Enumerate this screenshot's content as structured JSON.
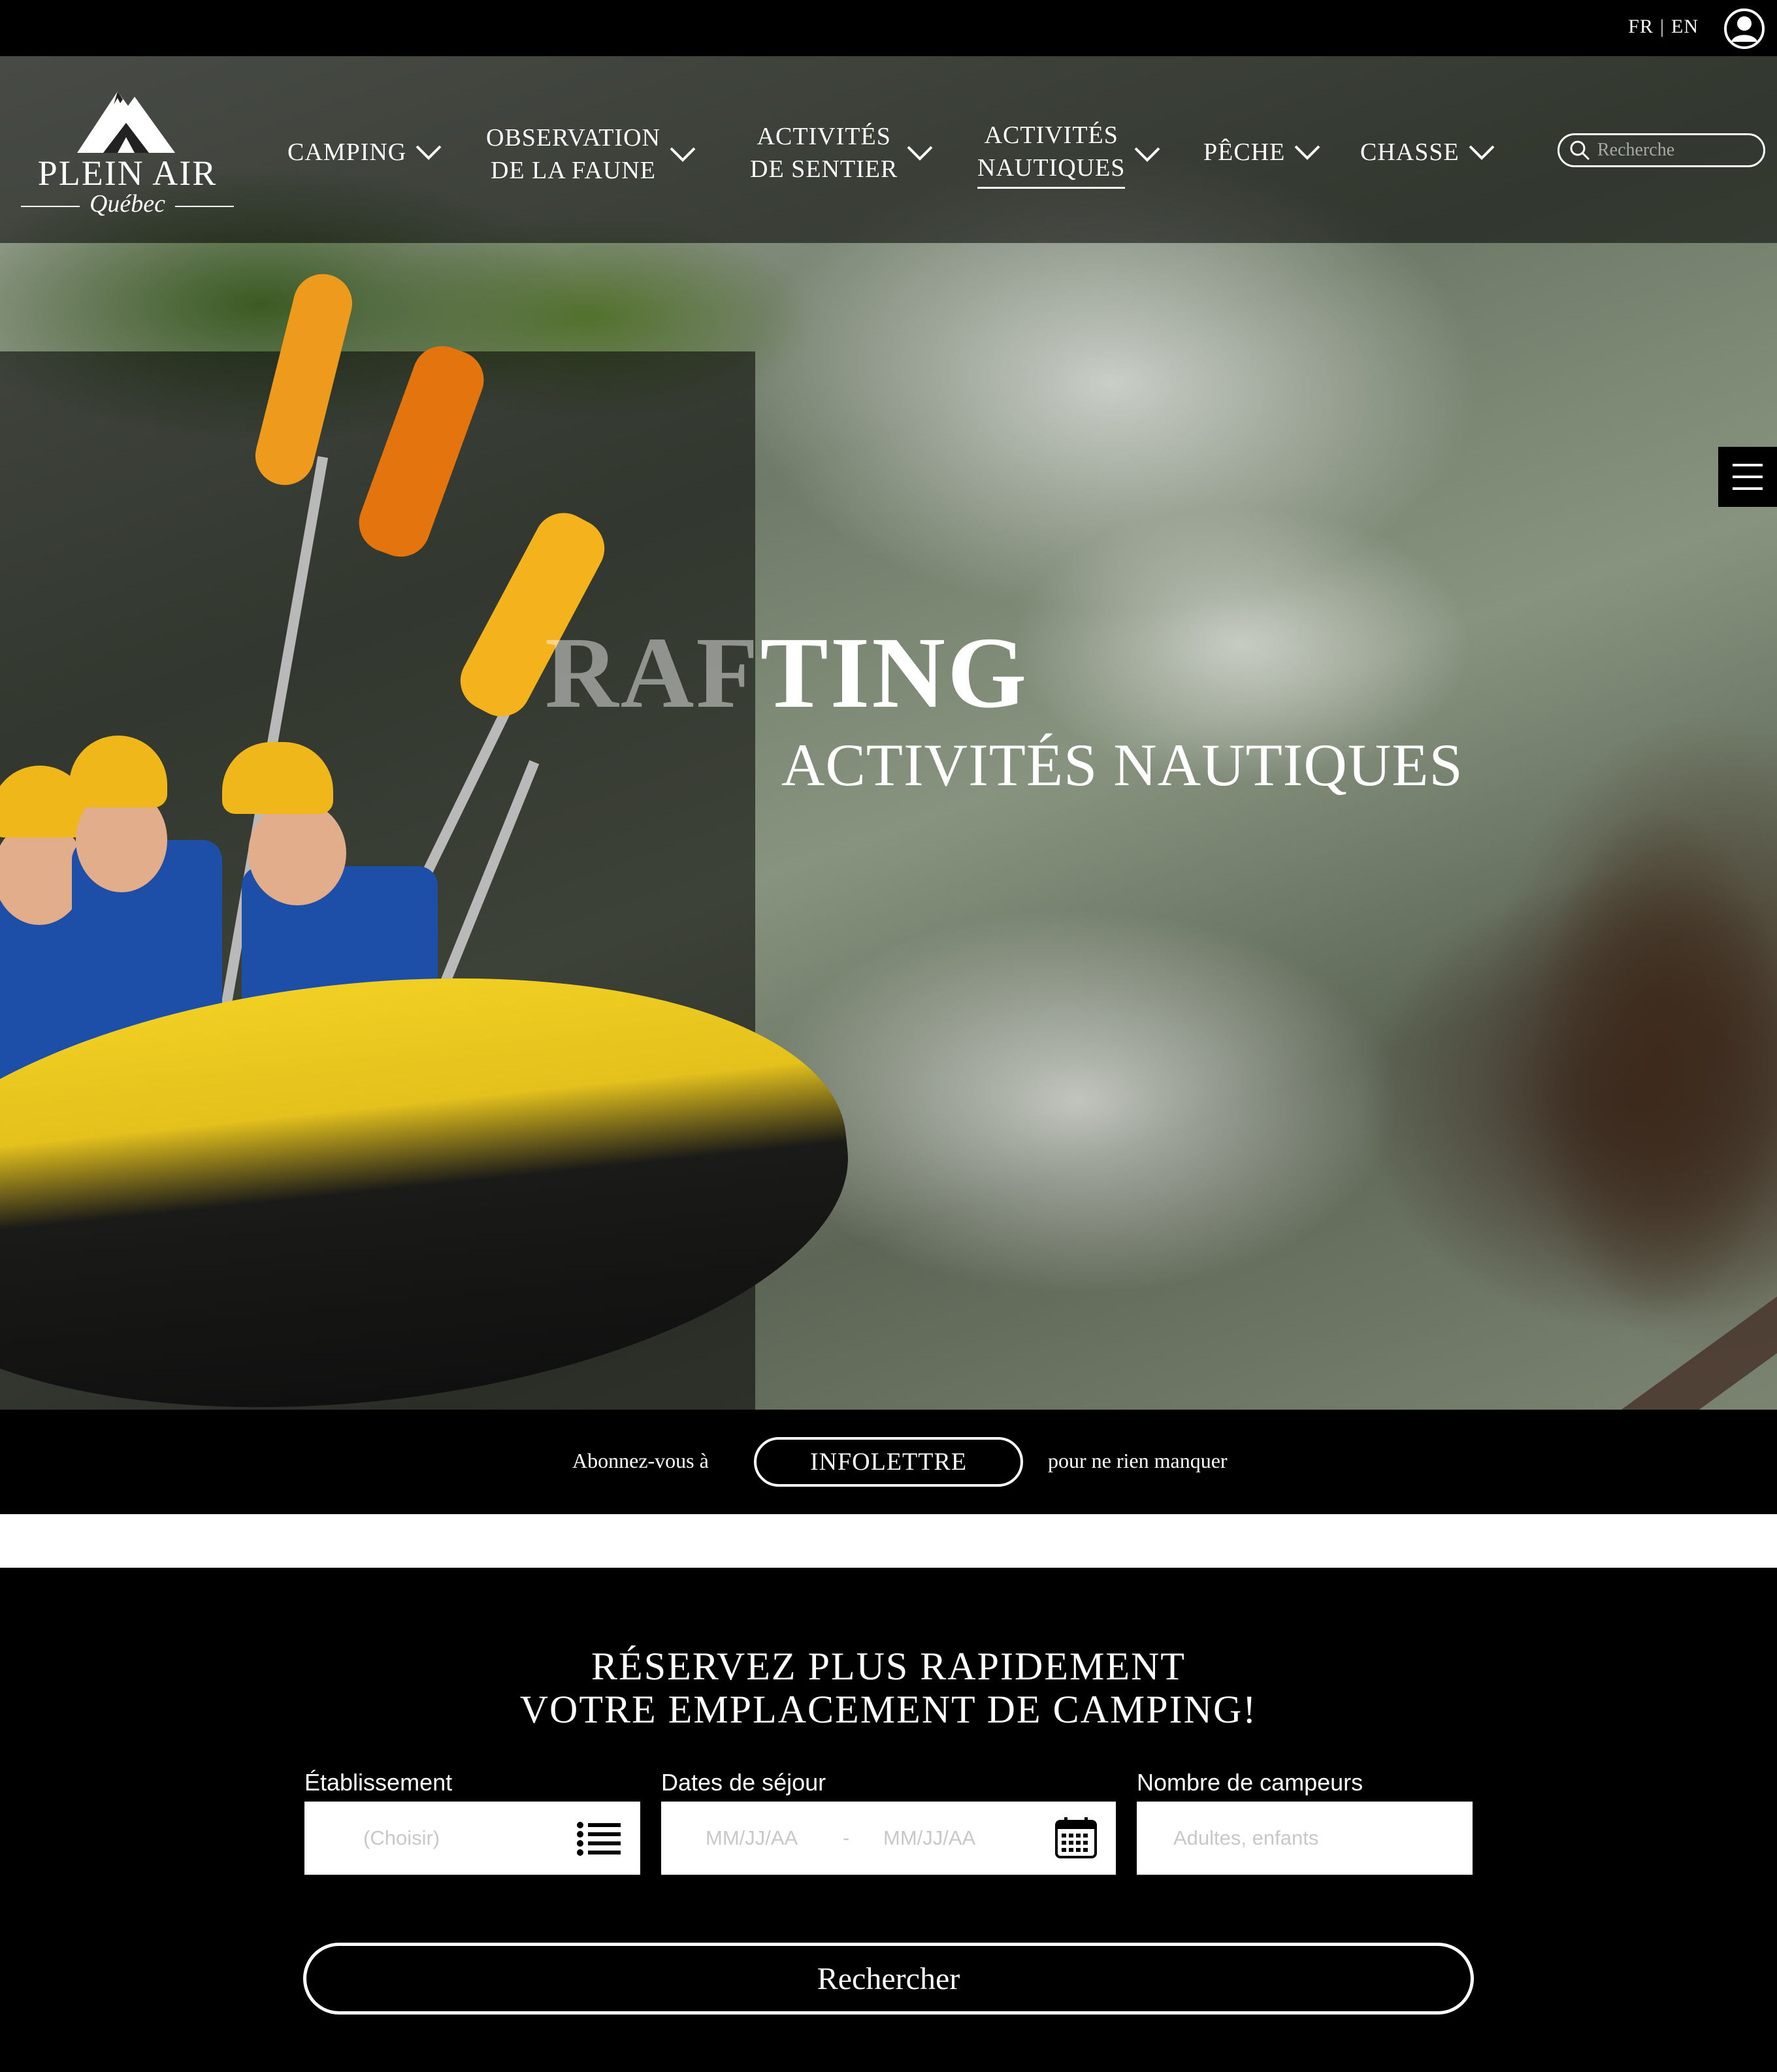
{
  "topbar": {
    "lang_fr": "FR",
    "lang_sep": "|",
    "lang_en": "EN",
    "user_icon": "user-account-icon"
  },
  "brand": {
    "title": "PLEIN AIR",
    "subtitle": "Québec",
    "logo_icon": "mountain-tent-icon"
  },
  "nav": {
    "items": [
      {
        "line1": "CAMPING",
        "line2": ""
      },
      {
        "line1": "OBSERVATION",
        "line2": "DE LA FAUNE"
      },
      {
        "line1": "ACTIVITÉS",
        "line2": "DE SENTIER"
      },
      {
        "line1": "ACTIVITÉS",
        "line2": "NAUTIQUES"
      },
      {
        "line1": "PÊCHE",
        "line2": ""
      },
      {
        "line1": "CHASSE",
        "line2": ""
      }
    ],
    "active_index": 3,
    "chevron_icon": "chevron-down-icon"
  },
  "search": {
    "placeholder": "Recherche",
    "icon": "search-icon"
  },
  "side_menu_icon": "hamburger-menu-icon",
  "hero": {
    "headline_dim": "RAF",
    "headline_bright": "TING",
    "subheadline": "ACTIVITÉS NAUTIQUES"
  },
  "newsletter": {
    "pre_text": "Abonnez-vous à",
    "button_label": "INFOLETTRE",
    "post_text": "pour ne rien manquer"
  },
  "booking": {
    "heading_line1": "RÉSERVEZ PLUS RAPIDEMENT",
    "heading_line2": "VOTRE EMPLACEMENT DE CAMPING!",
    "establishment": {
      "label": "Établissement",
      "placeholder": "(Choisir)",
      "icon": "list-icon"
    },
    "dates": {
      "label": "Dates de séjour",
      "from_placeholder": "MM/JJ/AA",
      "separator": "-",
      "to_placeholder": "MM/JJ/AA",
      "icon": "calendar-icon"
    },
    "campers": {
      "label": "Nombre de campeurs",
      "placeholder": "Adultes, enfants"
    },
    "submit_label": "Rechercher"
  },
  "colors": {
    "background": "#000000",
    "text": "#ffffff",
    "field_background": "#ffffff",
    "placeholder": "#c8c8c8",
    "raft_yellow": "#f1cf23",
    "vest_blue": "#1e4fa8"
  }
}
